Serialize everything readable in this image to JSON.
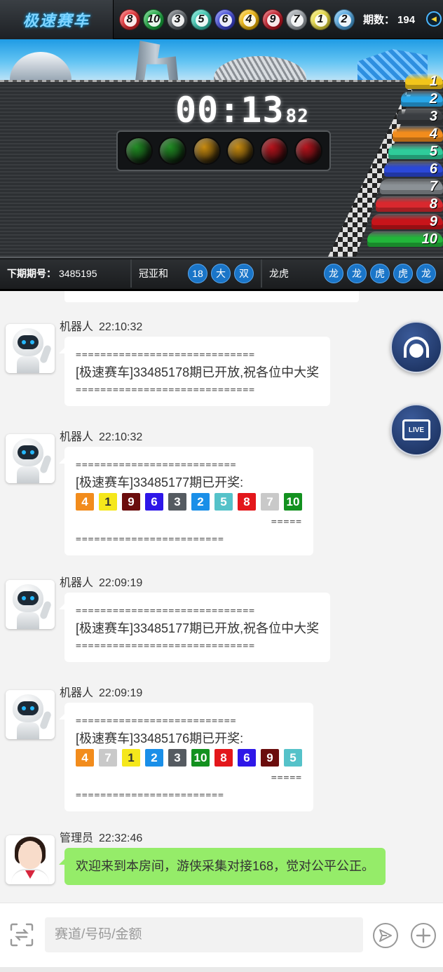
{
  "header": {
    "logo": "极速赛车",
    "balls": [
      {
        "num": "8",
        "color": "#e4252b"
      },
      {
        "num": "10",
        "color": "#14a83b"
      },
      {
        "num": "3",
        "color": "#555b61"
      },
      {
        "num": "5",
        "color": "#33c7b0"
      },
      {
        "num": "6",
        "color": "#3a43d6"
      },
      {
        "num": "4",
        "color": "#f0b400"
      },
      {
        "num": "9",
        "color": "#c1121f"
      },
      {
        "num": "7",
        "color": "#9aa0a6"
      },
      {
        "num": "1",
        "color": "#e6d93a"
      },
      {
        "num": "2",
        "color": "#4aa3df"
      }
    ],
    "issue_label": "期数：",
    "issue_value": "194"
  },
  "timer": {
    "main": "00:13",
    "ms": "82"
  },
  "lights": [
    "#1f8a22",
    "#1f8a22",
    "#c78a0e",
    "#c78a0e",
    "#b5121b",
    "#b5121b"
  ],
  "cars": [
    {
      "num": "1",
      "color": "#f2c51b"
    },
    {
      "num": "2",
      "color": "#28a6e8"
    },
    {
      "num": "3",
      "color": "#3a3d41"
    },
    {
      "num": "4",
      "color": "#f28c1c"
    },
    {
      "num": "5",
      "color": "#2fcc9a"
    },
    {
      "num": "6",
      "color": "#2b48d8"
    },
    {
      "num": "7",
      "color": "#8b9196"
    },
    {
      "num": "8",
      "color": "#d9282e"
    },
    {
      "num": "9",
      "color": "#c8141a"
    },
    {
      "num": "10",
      "color": "#22b63a"
    }
  ],
  "info_strip": {
    "next_label": "下期期号：",
    "next_value": "3485195",
    "champion_label": "冠亚和",
    "champion": [
      "18",
      "大",
      "双"
    ],
    "dragon_label": "龙虎",
    "dragon": [
      "龙",
      "龙",
      "虎",
      "虎",
      "龙"
    ]
  },
  "messages": [
    {
      "sender": "机器人",
      "time": "22:10:32",
      "sep_top": "=============================",
      "text": "[极速赛车]33485178期已开放,祝各位中大奖",
      "sep_bottom": "============================="
    },
    {
      "sender": "机器人",
      "time": "22:10:32",
      "sep_top": "==========================",
      "text": "[极速赛车]33485177期已开奖:",
      "numbers": [
        "4",
        "1",
        "9",
        "6",
        "3",
        "2",
        "5",
        "8",
        "7",
        "10"
      ],
      "sep_mid": "=====",
      "sep_bottom": "========================"
    },
    {
      "sender": "机器人",
      "time": "22:09:19",
      "sep_top": "=============================",
      "text": "[极速赛车]33485177期已开放,祝各位中大奖",
      "sep_bottom": "============================="
    },
    {
      "sender": "机器人",
      "time": "22:09:19",
      "sep_top": "==========================",
      "text": "[极速赛车]33485176期已开奖:",
      "numbers": [
        "4",
        "7",
        "1",
        "2",
        "3",
        "10",
        "8",
        "6",
        "9",
        "5"
      ],
      "sep_mid": "=====",
      "sep_bottom": "========================"
    },
    {
      "sender": "管理员",
      "time": "22:32:46",
      "text": "欢迎来到本房间，游侠采集对接168，觉对公平公正。"
    }
  ],
  "number_colors": {
    "1": "#f5e71b",
    "2": "#1a8fe8",
    "3": "#555b61",
    "4": "#f28c1c",
    "5": "#55c2c9",
    "6": "#2e17e8",
    "7": "#c9c9c9",
    "8": "#e3171b",
    "9": "#6b0d0d",
    "10": "#13911f"
  },
  "input": {
    "placeholder": "赛道/号码/金额"
  },
  "float_buttons": {
    "live_label": "LIVE"
  }
}
